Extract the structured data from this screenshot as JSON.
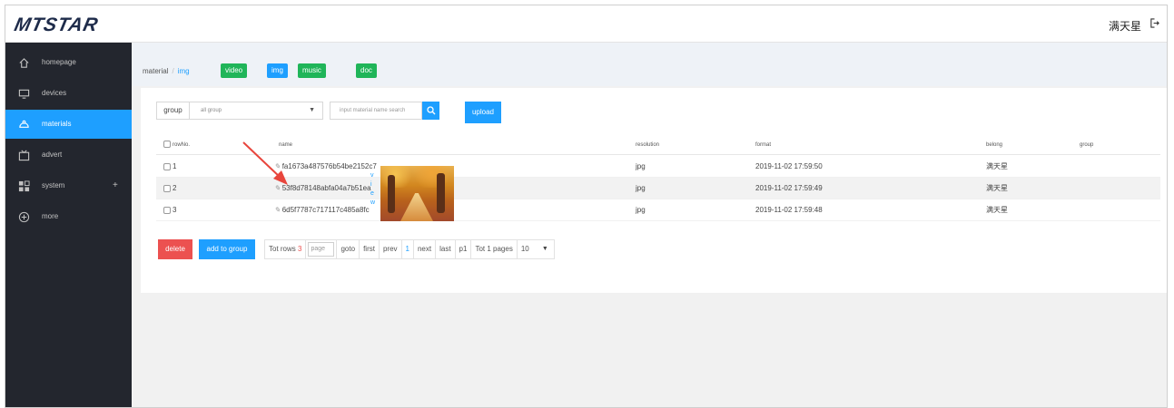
{
  "header": {
    "logo": "MTSTAR",
    "user_name": "满天星"
  },
  "sidebar": {
    "items": [
      {
        "label": "homepage"
      },
      {
        "label": "devices"
      },
      {
        "label": "materials"
      },
      {
        "label": "advert"
      },
      {
        "label": "system",
        "suffix": "+"
      },
      {
        "label": "more"
      }
    ],
    "active_index": 2
  },
  "breadcrumb": {
    "root": "material",
    "separator": "/",
    "current": "img"
  },
  "type_tags": [
    "video",
    "img",
    "music",
    "doc"
  ],
  "filter": {
    "group_label": "group",
    "group_value": "all group",
    "search_placeholder": "input material name search",
    "upload_label": "upload"
  },
  "table": {
    "columns": [
      "rowNo.",
      "name",
      "resolution",
      "format",
      "belong",
      "group"
    ],
    "rows": [
      {
        "no": "1",
        "name": "fa1673a487576b54be2152c7",
        "resolution": "jpg",
        "format": "2019-11-02 17:59:50",
        "belong": "满天星",
        "group": ""
      },
      {
        "no": "2",
        "name": "53f8d78148abfa04a7b51ea",
        "resolution": "jpg",
        "format": "2019-11-02 17:59:49",
        "belong": "满天星",
        "group": ""
      },
      {
        "no": "3",
        "name": "6d5f7787c717117c485a8fc",
        "resolution": "jpg",
        "format": "2019-11-02 17:59:48",
        "belong": "满天星",
        "group": ""
      }
    ],
    "hover_letters": [
      "v",
      "i",
      "e",
      "w"
    ]
  },
  "actions": {
    "delete_label": "delete",
    "add_to_group_label": "add to group"
  },
  "pager": {
    "tot_rows_label": "Tot rows",
    "tot_rows_value": "3",
    "page_placeholder": "page",
    "goto": "goto",
    "first": "first",
    "prev": "prev",
    "current_page": "1",
    "next": "next",
    "last": "last",
    "p1": "p1",
    "tot_pages": "Tot 1 pages",
    "page_size": "10"
  },
  "colors": {
    "sidebar_bg": "#23262e",
    "accent_blue": "#1e9fff",
    "tag_green": "#20b559",
    "delete_red": "#ec5150"
  }
}
